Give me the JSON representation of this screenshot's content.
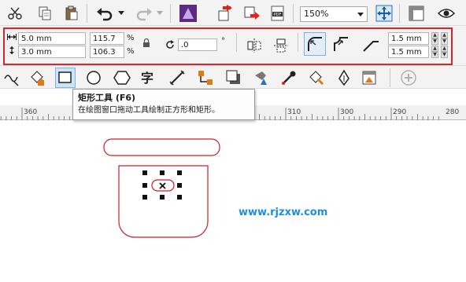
{
  "toolbar": {
    "zoom_value": "150%",
    "icons": [
      "cut-icon",
      "copy-icon",
      "paste-icon",
      "undo-icon",
      "redo-icon",
      "corel-app-icon",
      "import-icon",
      "export-icon",
      "publish-pdf-icon",
      "zoom-to-page-icon",
      "options-icon",
      "view-icon"
    ]
  },
  "property_bar": {
    "width_value": "5.0 mm",
    "height_value": "3.0 mm",
    "scale_x": "115.7",
    "scale_y": "106.3",
    "percent_symbol": "%",
    "rotation_value": ".0",
    "degree_symbol": "°",
    "corner_radius_top": "1.5 mm",
    "corner_radius_bottom": "1.5 mm"
  },
  "toolbox": {
    "items": [
      "freehand-tool",
      "smart-fill-tool",
      "rectangle-tool",
      "ellipse-tool",
      "polygon-tool",
      "text-tool",
      "dimension-tool",
      "connector-tool",
      "drop-shadow-tool",
      "transparency-tool",
      "eyedropper-tool",
      "fill-tool",
      "outline-pen-tool",
      "property-tool",
      "add-tool"
    ]
  },
  "ruler": {
    "ticks": [
      "360",
      "350",
      "340",
      "330",
      "320",
      "310",
      "300",
      "290",
      "280",
      "270"
    ]
  },
  "tooltip": {
    "title": "矩形工具 (F6)",
    "description": "在绘图窗口拖动工具绘制正方形和矩形。"
  },
  "watermark": {
    "text": "www.rjzxw.com"
  },
  "colors": {
    "highlight_red": "#e0222a",
    "shape_outline": "#c8202a",
    "watermark_blue": "#1e8fd8",
    "toolbar_bg": "#f3f3f3"
  }
}
